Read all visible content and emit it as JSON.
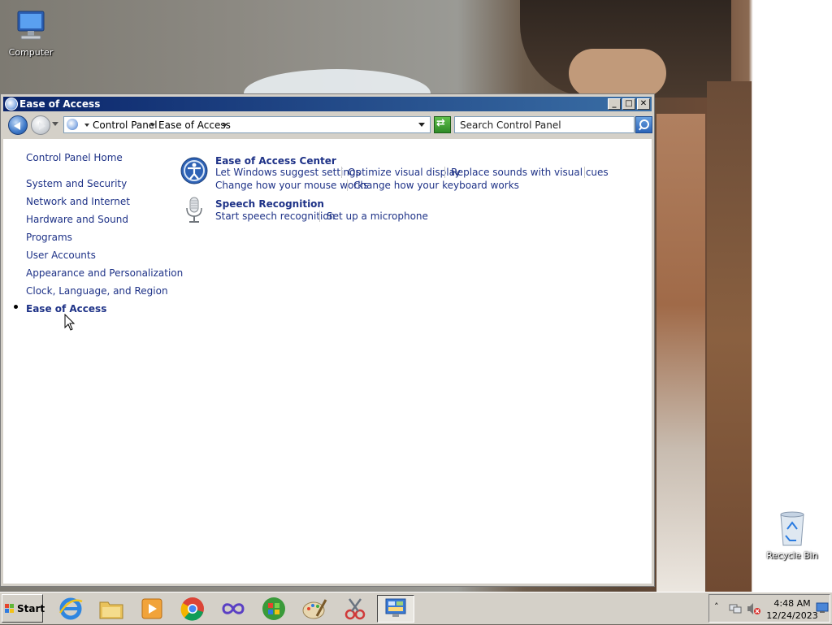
{
  "desktop": {
    "computer_label": "Computer",
    "recycle_label": "Recycle Bin"
  },
  "window": {
    "title": "Ease of Access",
    "address": {
      "crumbs": [
        "Control Panel",
        "Ease of Access"
      ]
    },
    "search": {
      "placeholder": "Search Control Panel"
    },
    "nav": {
      "home": "Control Panel Home",
      "items": [
        "System and Security",
        "Network and Internet",
        "Hardware and Sound",
        "Programs",
        "User Accounts",
        "Appearance and Personalization",
        "Clock, Language, and Region",
        "Ease of Access"
      ]
    },
    "sections": [
      {
        "title": "Ease of Access Center",
        "icon": "ease-of-access-icon",
        "tasks": [
          "Let Windows suggest settings",
          "Optimize visual display",
          "Replace sounds with visual cues",
          "Change how your mouse works",
          "Change how your keyboard works"
        ]
      },
      {
        "title": "Speech Recognition",
        "icon": "microphone-icon",
        "tasks": [
          "Start speech recognition",
          "Set up a microphone"
        ]
      }
    ]
  },
  "taskbar": {
    "start_label": "Start",
    "clock": {
      "time": "4:48 AM",
      "date": "12/24/2023"
    }
  }
}
